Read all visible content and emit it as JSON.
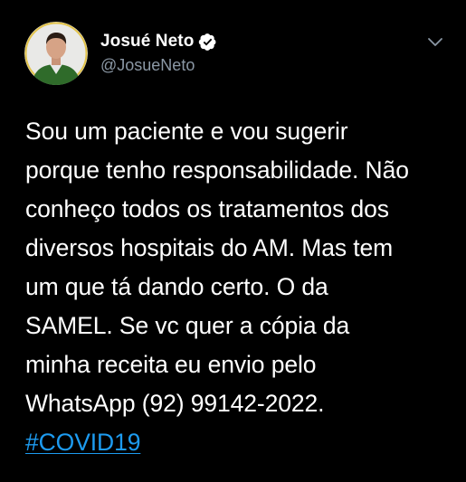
{
  "author": {
    "display_name": "Josué Neto",
    "handle": "@JosueNeto",
    "verified": true,
    "avatar_icon": "profile-photo"
  },
  "menu": {
    "icon": "chevron-down-icon"
  },
  "tweet": {
    "lines": [
      "Sou um paciente e vou sugerir",
      "porque tenho responsabilidade. Não",
      "conheço todos os tratamentos dos",
      "diversos hospitais do AM. Mas tem",
      "um que tá dando certo. O da",
      "SAMEL. Se vc quer a cópia da",
      "minha receita eu envio pelo",
      "WhatsApp (92) 99142-2022."
    ],
    "hashtag": "#COVID19"
  },
  "colors": {
    "background": "#000000",
    "text": "#ffffff",
    "secondary_text": "#8b98a5",
    "link": "#1d9bf0",
    "verified_badge": "#ffffff"
  }
}
